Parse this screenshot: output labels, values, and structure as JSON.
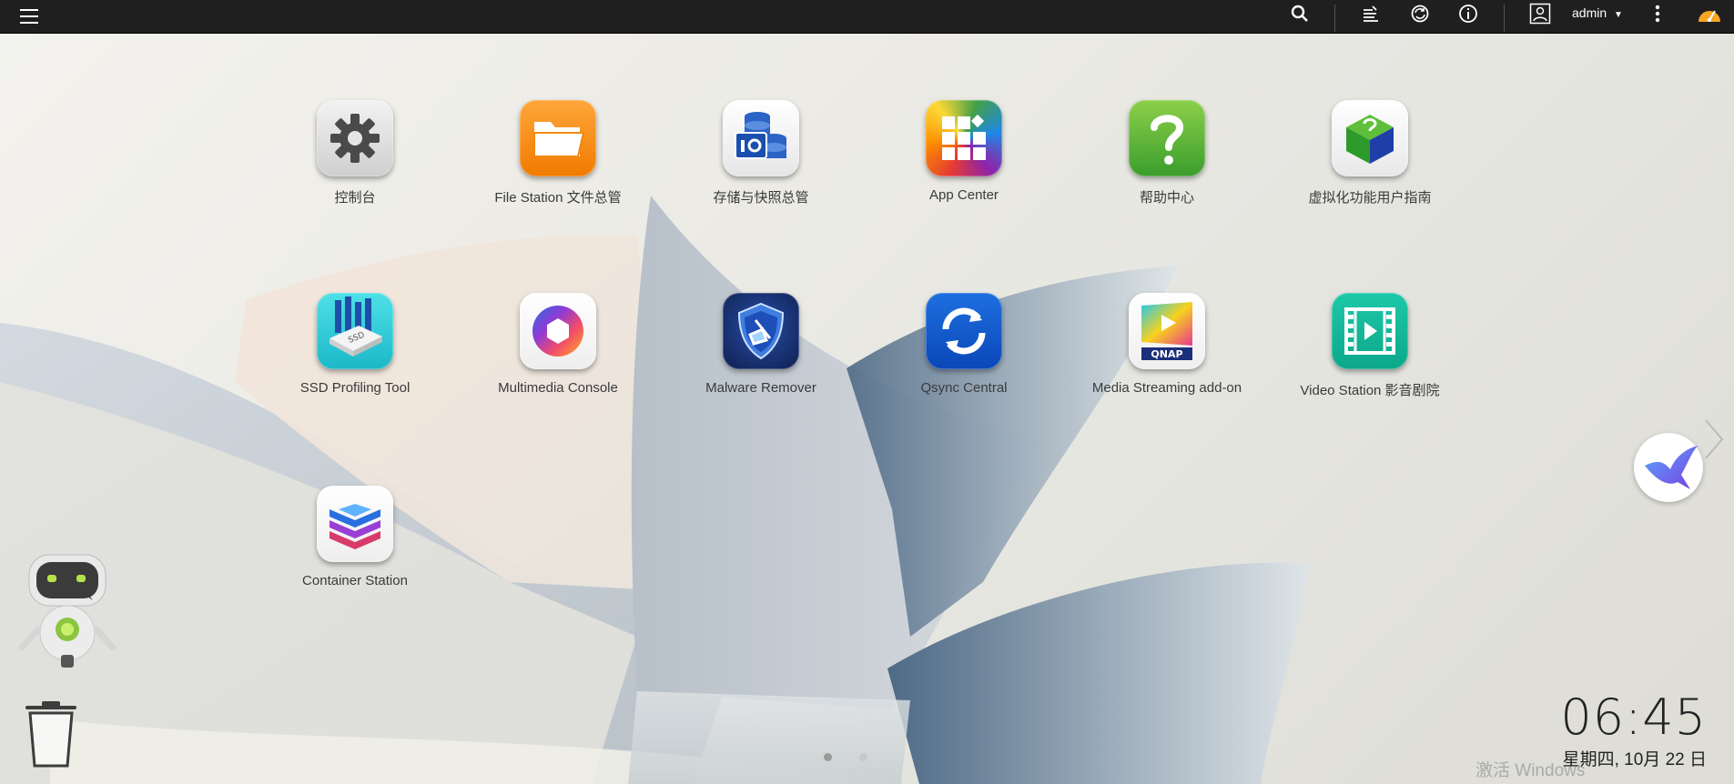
{
  "topbar": {
    "menu_icon": "hamburger-icon",
    "search_icon": "search-icon",
    "tasks_icon": "stack-icon",
    "sync_icon": "sync-icon",
    "info_icon": "info-icon",
    "user_icon": "user-icon",
    "username": "admin",
    "more_icon": "more-vertical-icon",
    "dashboard_icon": "speedometer-icon"
  },
  "apps": [
    {
      "label": "控制台",
      "icon": "gear-icon"
    },
    {
      "label": "File Station 文件总管",
      "icon": "folder-icon"
    },
    {
      "label": "存储与快照总管",
      "icon": "storage-icon"
    },
    {
      "label": "App Center",
      "icon": "app-grid-icon"
    },
    {
      "label": "帮助中心",
      "icon": "question-icon"
    },
    {
      "label": "虚拟化功能用户指南",
      "icon": "cube-question-icon"
    },
    {
      "label": "SSD Profiling Tool",
      "icon": "ssd-icon"
    },
    {
      "label": "Multimedia Console",
      "icon": "hexagon-color-icon"
    },
    {
      "label": "Malware Remover",
      "icon": "shield-broom-icon"
    },
    {
      "label": "Qsync Central",
      "icon": "sync-arrows-icon"
    },
    {
      "label": "Media Streaming add-on",
      "icon": "qnap-media-icon"
    },
    {
      "label": "Video Station 影音剧院",
      "icon": "film-icon"
    },
    {
      "label": "Container Station",
      "icon": "container-icon"
    }
  ],
  "clock": {
    "time": "06:45",
    "date": "星期四, 10月 22 日"
  },
  "watermark": "激活 Windows",
  "pager": {
    "pages": 2,
    "current": 1
  },
  "colors": {
    "topbar": "#1f1f1f",
    "accent": "#f5a623"
  }
}
